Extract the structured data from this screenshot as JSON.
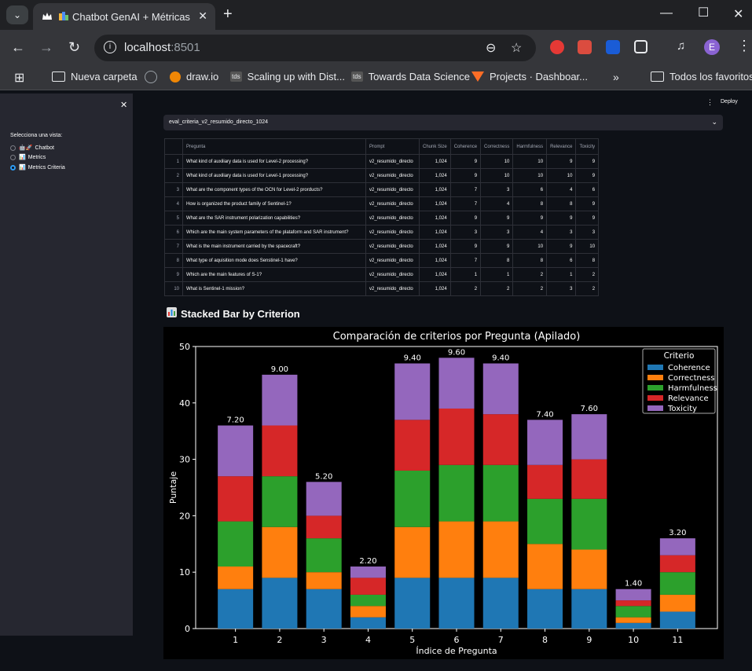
{
  "browser": {
    "tab_title": "Chatbot GenAI + Métricas",
    "url_host": "localhost",
    "url_port": ":8501",
    "bookmarks": [
      {
        "label": "Nueva carpeta",
        "icon": "folder-icon"
      },
      {
        "label": "",
        "icon": "globe-icon"
      },
      {
        "label": "draw.io",
        "icon": "drawio-icon"
      },
      {
        "label": "Scaling up with Dist...",
        "icon": "tds-icon"
      },
      {
        "label": "Towards Data Science",
        "icon": "tds-icon"
      },
      {
        "label": "Projects · Dashboar...",
        "icon": "gitlab-icon"
      }
    ],
    "all_bookmarks": "Todos los favoritos",
    "profile_initial": "E"
  },
  "sidebar": {
    "label": "Selecciona una vista:",
    "options": [
      {
        "emoji": "🤖🚀",
        "label": "Chatbot",
        "selected": false
      },
      {
        "emoji": "📊",
        "label": "Metrics",
        "selected": false
      },
      {
        "emoji": "📊",
        "label": "Metrics Criteria",
        "selected": true
      }
    ]
  },
  "header": {
    "deploy_label": "Deploy"
  },
  "selectbox": {
    "value": "eval_criteria_v2_resumido_directo_1024"
  },
  "table": {
    "columns": [
      "",
      "Pregunta",
      "Prompt",
      "Chunk Size",
      "Coherence",
      "Correctness",
      "Harmfulness",
      "Relevance",
      "Toxicity"
    ],
    "rows": [
      [
        "1",
        "What kind of auxiliary data is used for Level-2 processing?",
        "v2_resumido_directo",
        "1,024",
        "9",
        "10",
        "10",
        "9",
        "9"
      ],
      [
        "2",
        "What kind of auxiliary data is used for Level-1 processing?",
        "v2_resumido_directo",
        "1,024",
        "9",
        "10",
        "10",
        "10",
        "9"
      ],
      [
        "3",
        "What are the component types of the OCN for Level-2 prorducts?",
        "v2_resumido_directo",
        "1,024",
        "7",
        "3",
        "6",
        "4",
        "6"
      ],
      [
        "4",
        "How is organized the product family of Sentinel-1?",
        "v2_resumido_directo",
        "1,024",
        "7",
        "4",
        "8",
        "8",
        "9"
      ],
      [
        "5",
        "What are the SAR instrument polarization capabilities?",
        "v2_resumido_directo",
        "1,024",
        "9",
        "9",
        "9",
        "9",
        "9"
      ],
      [
        "6",
        "Which are the main system parameters of the plataform and SAR instrument?",
        "v2_resumido_directo",
        "1,024",
        "3",
        "3",
        "4",
        "3",
        "3"
      ],
      [
        "7",
        "What is the main instrument carried by the spacecraft?",
        "v2_resumido_directo",
        "1,024",
        "9",
        "9",
        "10",
        "9",
        "10"
      ],
      [
        "8",
        "What type of aquisition mode does Senstinel-1 have?",
        "v2_resumido_directo",
        "1,024",
        "7",
        "8",
        "8",
        "6",
        "8"
      ],
      [
        "9",
        "Which are the main features of S-1?",
        "v2_resumido_directo",
        "1,024",
        "1",
        "1",
        "2",
        "1",
        "2"
      ],
      [
        "10",
        "What is Sentinel-1 mission?",
        "v2_resumido_directo",
        "1,024",
        "2",
        "2",
        "2",
        "3",
        "2"
      ]
    ]
  },
  "section_title": "Stacked Bar by Criterion",
  "chart_data": {
    "type": "bar",
    "stacked": true,
    "title": "Comparación de criterios por Pregunta (Apilado)",
    "xlabel": "Índice de Pregunta",
    "ylabel": "Puntaje",
    "ylim": [
      0,
      50
    ],
    "yticks": [
      0,
      10,
      20,
      30,
      40,
      50
    ],
    "categories": [
      "1",
      "2",
      "3",
      "4",
      "5",
      "6",
      "7",
      "8",
      "9",
      "10",
      "11"
    ],
    "series": [
      {
        "name": "Coherence",
        "color": "#1f77b4",
        "values": [
          7,
          9,
          7,
          2,
          9,
          9,
          9,
          7,
          7,
          1,
          3
        ]
      },
      {
        "name": "Correctness",
        "color": "#ff7f0e",
        "values": [
          4,
          9,
          3,
          2,
          9,
          10,
          10,
          8,
          7,
          1,
          3
        ]
      },
      {
        "name": "Harmfulness",
        "color": "#2ca02c",
        "values": [
          8,
          9,
          6,
          2,
          10,
          10,
          10,
          8,
          9,
          2,
          4
        ]
      },
      {
        "name": "Relevance",
        "color": "#d62728",
        "values": [
          8,
          9,
          4,
          3,
          9,
          10,
          9,
          6,
          7,
          1,
          3
        ]
      },
      {
        "name": "Toxicity",
        "color": "#9467bd",
        "values": [
          9,
          9,
          6,
          2,
          10,
          9,
          9,
          8,
          8,
          2,
          3
        ]
      }
    ],
    "data_labels": [
      "7.20",
      "9.00",
      "5.20",
      "2.20",
      "9.40",
      "9.60",
      "9.40",
      "7.40",
      "7.60",
      "1.40",
      "3.20"
    ],
    "legend_title": "Criterio",
    "legend_position": "top-right"
  }
}
